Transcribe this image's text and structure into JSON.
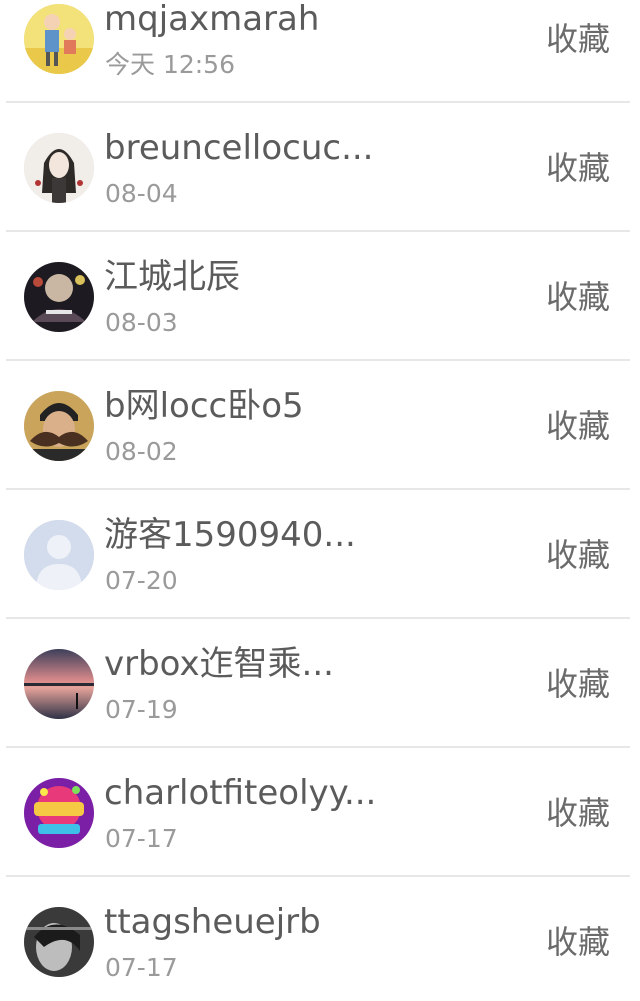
{
  "items": [
    {
      "name": "mqjaxmarah",
      "date": "今天 12:56",
      "action": "收藏",
      "avatar": "avatar-cartoon-couple"
    },
    {
      "name": "breuncellocuc...",
      "date": "08-04",
      "action": "收藏",
      "avatar": "avatar-woman-illustration"
    },
    {
      "name": "江城北辰",
      "date": "08-03",
      "action": "收藏",
      "avatar": "avatar-dark-crowd"
    },
    {
      "name": "b网locc卧o5",
      "date": "08-02",
      "action": "收藏",
      "avatar": "avatar-mustache-man"
    },
    {
      "name": "游客1590940...",
      "date": "07-20",
      "action": "收藏",
      "avatar": "avatar-default-user"
    },
    {
      "name": "vrbox迮智乘...",
      "date": "07-19",
      "action": "收藏",
      "avatar": "avatar-sunset-lake"
    },
    {
      "name": "charlotfiteolyy...",
      "date": "07-17",
      "action": "收藏",
      "avatar": "avatar-colorful-logo"
    },
    {
      "name": "ttagsheuejrb",
      "date": "07-17",
      "action": "收藏",
      "avatar": "avatar-bw-portrait"
    }
  ]
}
